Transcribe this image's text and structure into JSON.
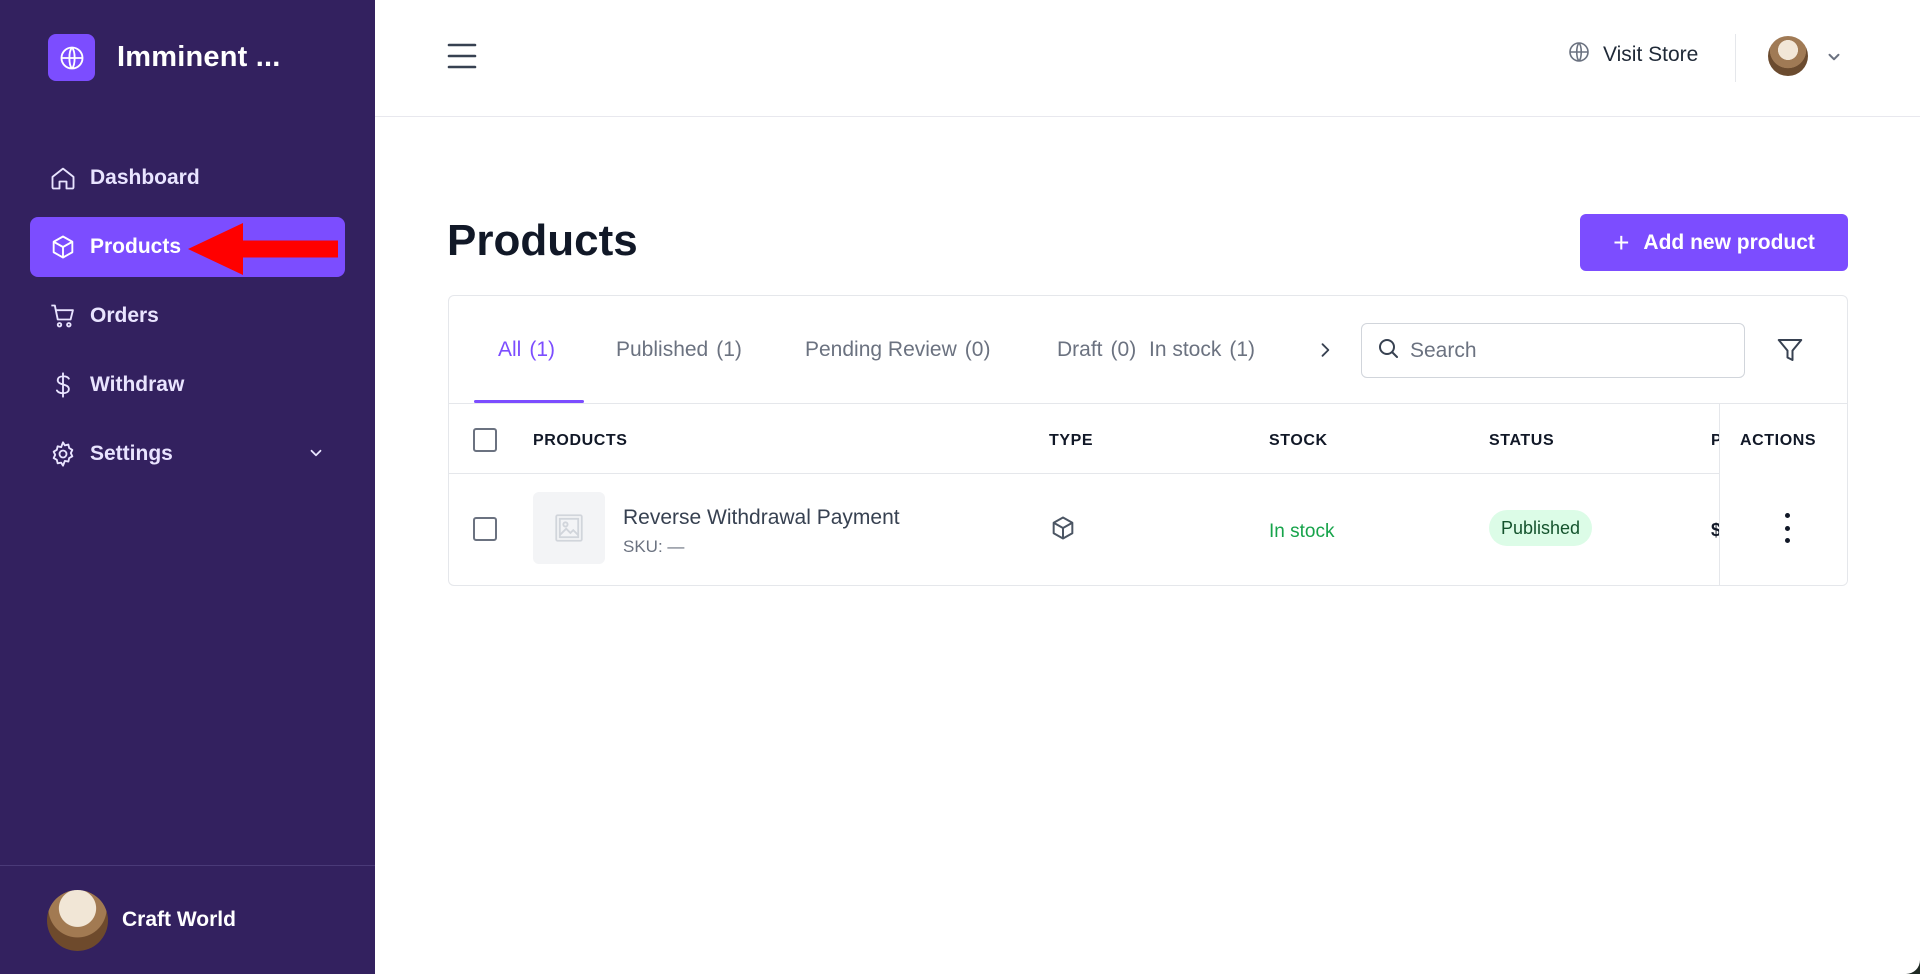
{
  "brand": {
    "name": "Imminent ...",
    "logo_icon": "globe-icon"
  },
  "sidebar": {
    "items": [
      {
        "label": "Dashboard",
        "icon": "home-icon"
      },
      {
        "label": "Products",
        "icon": "box-icon",
        "active": true
      },
      {
        "label": "Orders",
        "icon": "cart-icon"
      },
      {
        "label": "Withdraw",
        "icon": "dollar-icon"
      },
      {
        "label": "Settings",
        "icon": "gear-icon",
        "has_submenu": true
      }
    ],
    "footer": {
      "name": "Craft World"
    }
  },
  "header": {
    "visit_store": "Visit Store"
  },
  "page": {
    "title": "Products",
    "add_button": "Add new product"
  },
  "tabs": [
    {
      "label": "All",
      "count": "(1)",
      "active": true
    },
    {
      "label": "Published",
      "count": "(1)"
    },
    {
      "label": "Pending Review",
      "count": "(0)"
    },
    {
      "label": "Draft",
      "count": "(0)"
    },
    {
      "label": "In stock",
      "count": "(1)"
    }
  ],
  "search": {
    "placeholder": "Search"
  },
  "table": {
    "columns": [
      "PRODUCTS",
      "TYPE",
      "STOCK",
      "STATUS",
      "P",
      "ACTIONS"
    ],
    "rows": [
      {
        "name": "Reverse Withdrawal Payment",
        "sku": "SKU: —",
        "type_icon": "box-icon",
        "stock": "In stock",
        "status": "Published",
        "price": "$"
      }
    ]
  },
  "colors": {
    "sidebar": "#33215f",
    "accent": "#7c4dff",
    "stock_green": "#16a34a",
    "badge_bg": "#dcfce7"
  }
}
